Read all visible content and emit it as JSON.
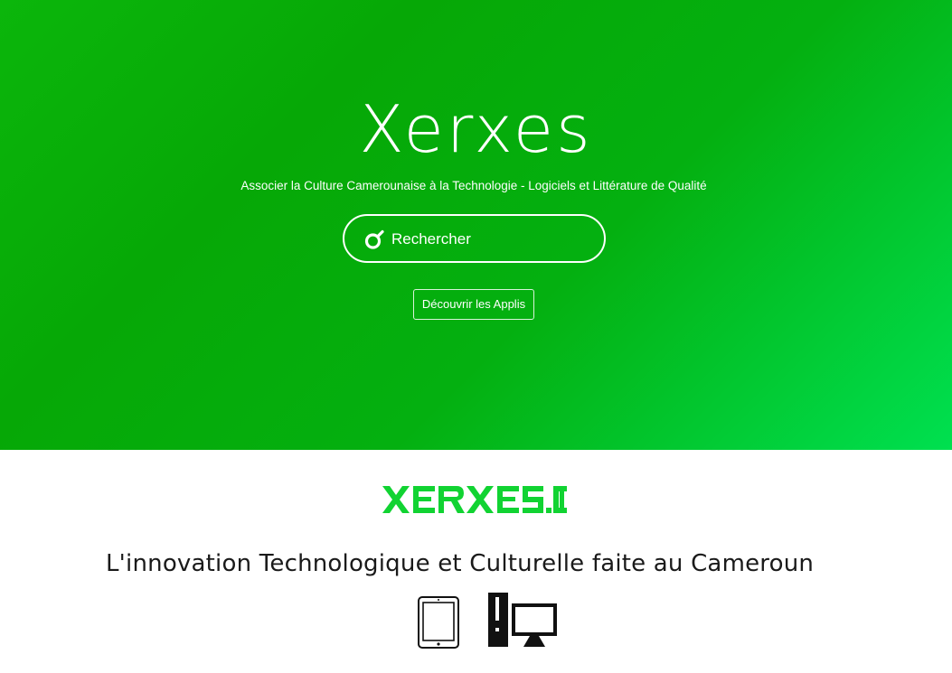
{
  "hero": {
    "title": "Xerxes",
    "subtitle": "Associer la Culture Camerounaise à la Technologie - Logiciels et Littérature de Qualité",
    "search": {
      "placeholder": "Rechercher",
      "value": "",
      "icon": "search-icon"
    },
    "discover_label": "Découvrir les Applis"
  },
  "main": {
    "logo_text": "XERXES.CM",
    "tagline": "L'innovation Technologique et Culturelle faite au Cameroun",
    "device_icons": [
      "tablet-icon",
      "desktop-icon"
    ]
  },
  "colors": {
    "brand_green": "#0aa80a",
    "brand_green_light": "#00e050",
    "logo_green": "#11d332",
    "text_dark": "#1a1a1a",
    "white": "#ffffff"
  }
}
